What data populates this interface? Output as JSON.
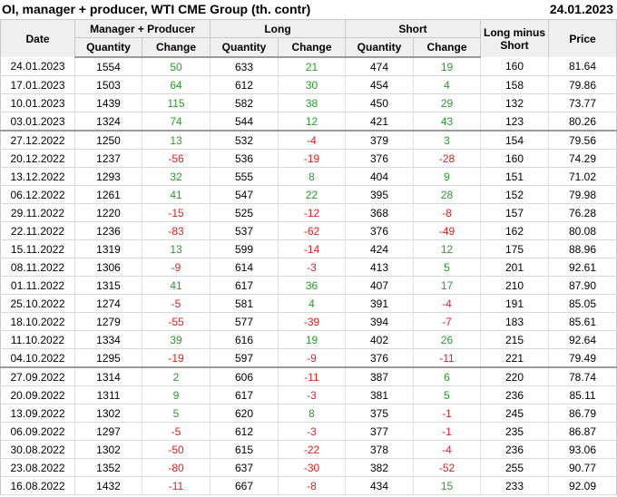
{
  "header": {
    "title": "OI, manager + producer, WTI CME Group (th. contr)",
    "date": "24.01.2023"
  },
  "table": {
    "col_date": "Date",
    "group_mp": "Manager + Producer",
    "group_long": "Long",
    "group_short": "Short",
    "col_lms": "Long minus Short",
    "col_price": "Price",
    "sub_quantity": "Quantity",
    "sub_change": "Change",
    "colors": {
      "positive": "#2a9a2a",
      "negative": "#e02020"
    },
    "rows": [
      [
        "24.01.2023",
        "1554",
        "50",
        "633",
        "21",
        "474",
        "19",
        "160",
        "81.64"
      ],
      [
        "17.01.2023",
        "1503",
        "64",
        "612",
        "30",
        "454",
        "4",
        "158",
        "79.86"
      ],
      [
        "10.01.2023",
        "1439",
        "115",
        "582",
        "38",
        "450",
        "29",
        "132",
        "73.77"
      ],
      [
        "03.01.2023",
        "1324",
        "74",
        "544",
        "12",
        "421",
        "43",
        "123",
        "80.26"
      ],
      [
        "27.12.2022",
        "1250",
        "13",
        "532",
        "-4",
        "379",
        "3",
        "154",
        "79.56"
      ],
      [
        "20.12.2022",
        "1237",
        "-56",
        "536",
        "-19",
        "376",
        "-28",
        "160",
        "74.29"
      ],
      [
        "13.12.2022",
        "1293",
        "32",
        "555",
        "8",
        "404",
        "9",
        "151",
        "71.02"
      ],
      [
        "06.12.2022",
        "1261",
        "41",
        "547",
        "22",
        "395",
        "28",
        "152",
        "79.98"
      ],
      [
        "29.11.2022",
        "1220",
        "-15",
        "525",
        "-12",
        "368",
        "-8",
        "157",
        "76.28"
      ],
      [
        "22.11.2022",
        "1236",
        "-83",
        "537",
        "-62",
        "376",
        "-49",
        "162",
        "80.08"
      ],
      [
        "15.11.2022",
        "1319",
        "13",
        "599",
        "-14",
        "424",
        "12",
        "175",
        "88.96"
      ],
      [
        "08.11.2022",
        "1306",
        "-9",
        "614",
        "-3",
        "413",
        "5",
        "201",
        "92.61"
      ],
      [
        "01.11.2022",
        "1315",
        "41",
        "617",
        "36",
        "407",
        "17",
        "210",
        "87.90"
      ],
      [
        "25.10.2022",
        "1274",
        "-5",
        "581",
        "4",
        "391",
        "-4",
        "191",
        "85.05"
      ],
      [
        "18.10.2022",
        "1279",
        "-55",
        "577",
        "-39",
        "394",
        "-7",
        "183",
        "85.61"
      ],
      [
        "11.10.2022",
        "1334",
        "39",
        "616",
        "19",
        "402",
        "26",
        "215",
        "92.64"
      ],
      [
        "04.10.2022",
        "1295",
        "-19",
        "597",
        "-9",
        "376",
        "-11",
        "221",
        "79.49"
      ],
      [
        "27.09.2022",
        "1314",
        "2",
        "606",
        "-11",
        "387",
        "6",
        "220",
        "78.74"
      ],
      [
        "20.09.2022",
        "1311",
        "9",
        "617",
        "-3",
        "381",
        "5",
        "236",
        "85.11"
      ],
      [
        "13.09.2022",
        "1302",
        "5",
        "620",
        "8",
        "375",
        "-1",
        "245",
        "86.79"
      ],
      [
        "06.09.2022",
        "1297",
        "-5",
        "612",
        "-3",
        "377",
        "-1",
        "235",
        "86.87"
      ],
      [
        "30.08.2022",
        "1302",
        "-50",
        "615",
        "-22",
        "378",
        "-4",
        "236",
        "93.06"
      ],
      [
        "23.08.2022",
        "1352",
        "-80",
        "637",
        "-30",
        "382",
        "-52",
        "255",
        "90.77"
      ],
      [
        "16.08.2022",
        "1432",
        "-11",
        "667",
        "-8",
        "434",
        "15",
        "233",
        "92.09"
      ]
    ]
  }
}
